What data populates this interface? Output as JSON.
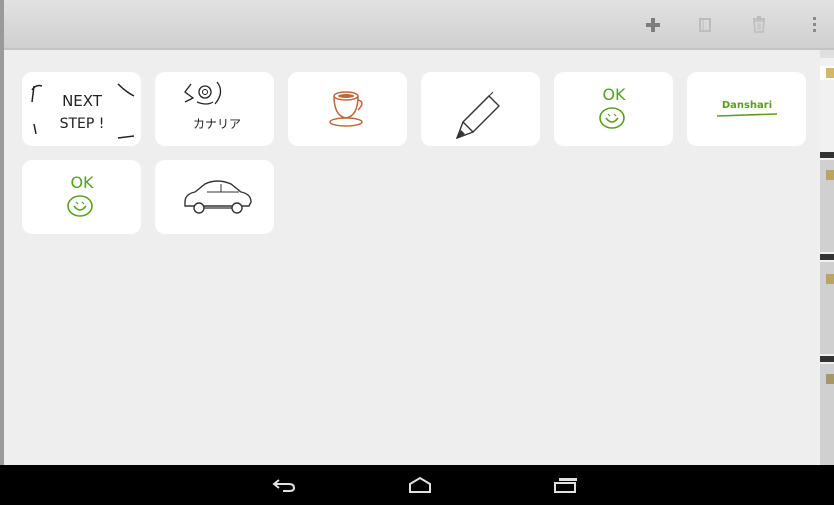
{
  "action_bar": {
    "icons": [
      "add-icon",
      "copy-icon",
      "trash-icon",
      "overflow-menu-icon"
    ]
  },
  "notes": [
    {
      "name": "note-next-step",
      "lines": [
        "NEXT",
        "STEP !"
      ],
      "color": "#222222"
    },
    {
      "name": "note-canaria",
      "lines": [
        "カナリア"
      ],
      "color": "#222222"
    },
    {
      "name": "note-coffee-cup",
      "lines": [],
      "color": "#c0663a",
      "icon": "coffee-cup-drawing"
    },
    {
      "name": "note-pencil",
      "lines": [],
      "color": "#333333",
      "icon": "pencil-drawing"
    },
    {
      "name": "note-ok-1",
      "lines": [
        "OK"
      ],
      "color": "#5a9e1f"
    },
    {
      "name": "note-danshari",
      "lines": [
        "Danshari"
      ],
      "color": "#5a9e1f"
    },
    {
      "name": "note-ok-2",
      "lines": [
        "OK"
      ],
      "color": "#5a9e1f"
    },
    {
      "name": "note-car",
      "lines": [],
      "color": "#333333",
      "icon": "car-drawing"
    }
  ],
  "nav_bar": {
    "icons": [
      "back-icon",
      "home-icon",
      "recent-apps-icon"
    ]
  }
}
